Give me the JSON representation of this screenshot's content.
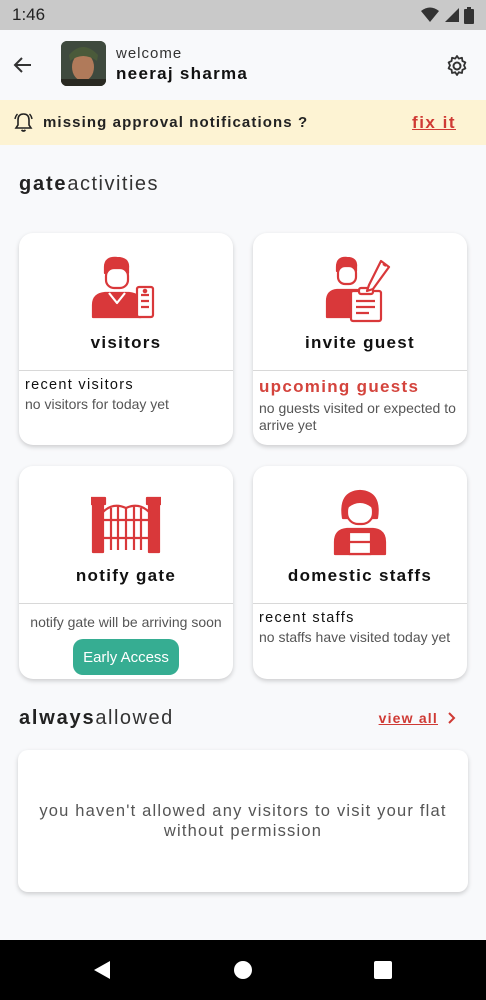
{
  "status_bar": {
    "time": "1:46"
  },
  "header": {
    "welcome": "welcome",
    "user_name": "neeraj sharma"
  },
  "alert": {
    "text": "missing approval notifications ?",
    "action": "fix it"
  },
  "gate_section": {
    "title_bold": "gate",
    "title_light": "activities"
  },
  "cards": {
    "visitors": {
      "title": "visitors",
      "sub_title": "recent visitors",
      "sub_text": "no visitors for today yet"
    },
    "invite_guest": {
      "title": "invite guest",
      "sub_title": "upcoming guests",
      "sub_text": "no guests visited or expected to arrive yet"
    },
    "notify_gate": {
      "title": "notify gate",
      "sub_text": "notify gate will be arriving soon",
      "button": "Early Access"
    },
    "domestic_staffs": {
      "title": "domestic staffs",
      "sub_title": "recent staffs",
      "sub_text": "no staffs have visited today yet"
    }
  },
  "always_section": {
    "title_bold": "always",
    "title_light": "allowed",
    "view_all": "view all",
    "empty_text": "you haven't allowed any visitors to visit your flat without permission"
  },
  "colors": {
    "accent_red": "#d4443d",
    "button_green": "#36ad92",
    "banner_bg": "#fdf3d3"
  }
}
